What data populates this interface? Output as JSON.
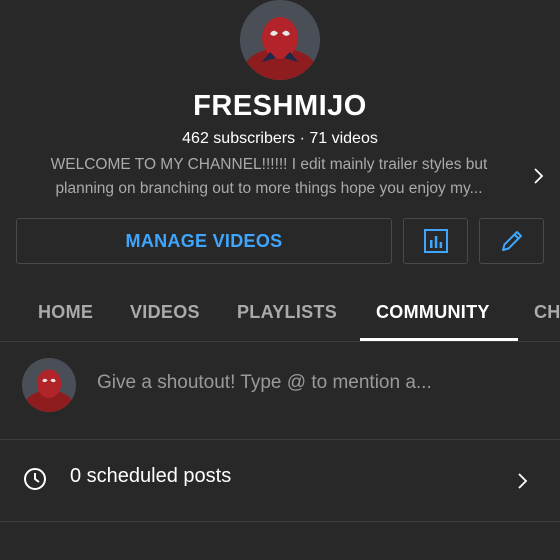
{
  "channel": {
    "name": "FRESHMIJO",
    "subscribers": "462 subscribers",
    "separator": "·",
    "videos": "71 videos",
    "description_line1": "WELCOME TO MY CHANNEL!!!!!!  I edit mainly trailer styles but",
    "description_line2": "planning on branching out to more things hope you enjoy my..."
  },
  "actions": {
    "manage_label": "MANAGE VIDEOS",
    "analytics_icon": "analytics-icon",
    "edit_icon": "pencil-icon",
    "accent_color": "#3ea6ff"
  },
  "tabs": [
    {
      "label": "HOME",
      "active": false
    },
    {
      "label": "VIDEOS",
      "active": false
    },
    {
      "label": "PLAYLISTS",
      "active": false
    },
    {
      "label": "COMMUNITY",
      "active": true
    },
    {
      "label": "CH",
      "active": false
    }
  ],
  "community": {
    "shoutout_placeholder": "Give a shoutout! Type @ to mention a...",
    "scheduled_label": "0 scheduled posts",
    "scheduled_icon": "clock-icon"
  },
  "colors": {
    "background": "#282828",
    "muted_text": "#aaaaaa",
    "divider": "#3d3d3d"
  }
}
